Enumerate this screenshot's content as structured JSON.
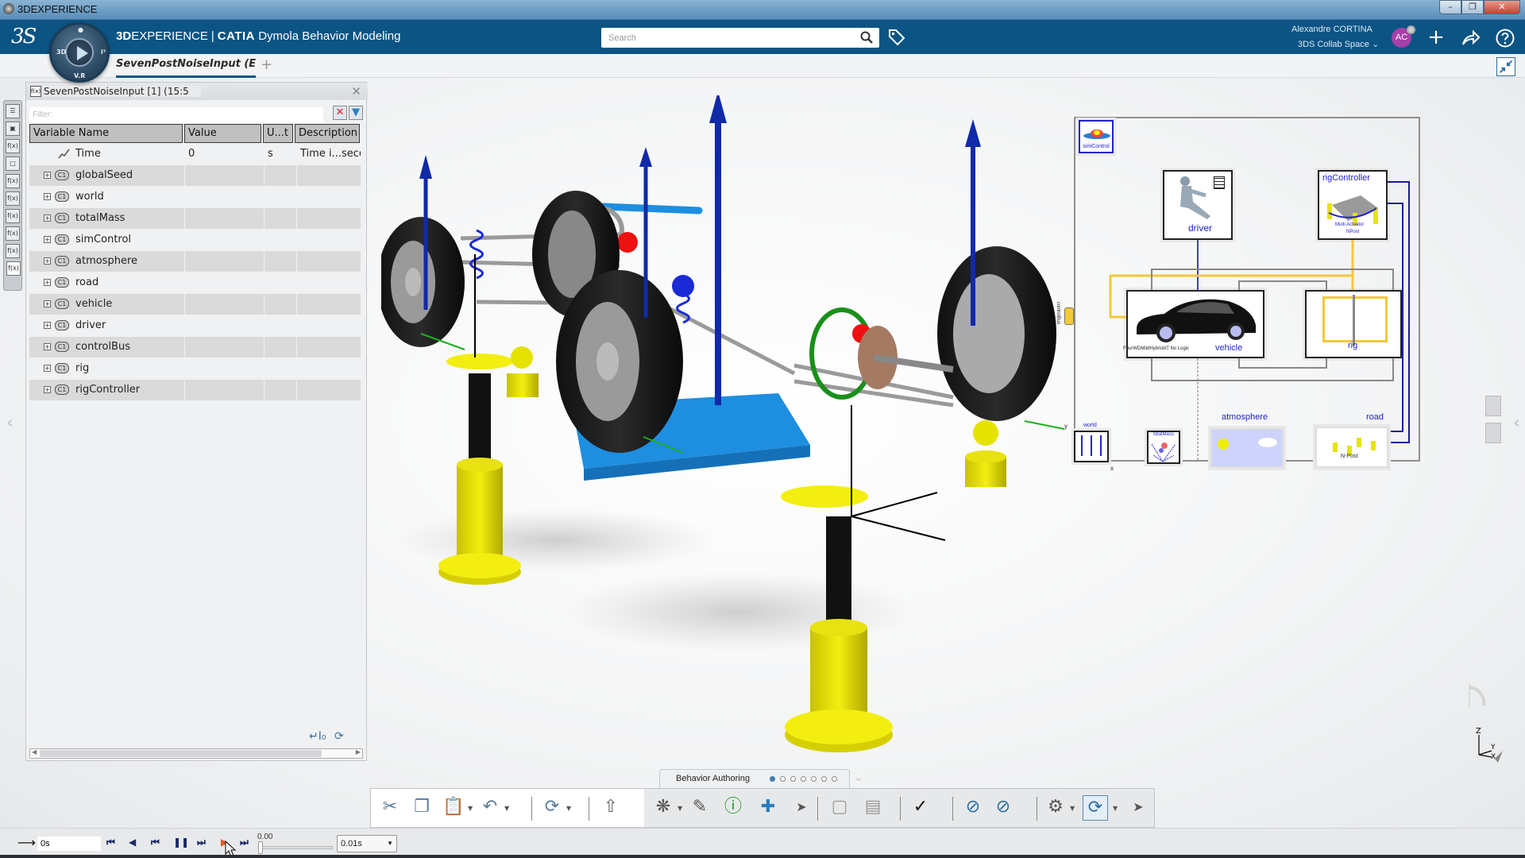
{
  "os_window": {
    "title": "3DEXPERIENCE",
    "buttons": [
      "minimize",
      "restore",
      "close"
    ]
  },
  "header": {
    "brand_3d": "3D",
    "brand_experience": "EXPERIENCE",
    "brand_separator": "|",
    "brand_catia": "CATIA",
    "app_name": "Dymola Behavior Modeling",
    "compass_labels": {
      "left": "3D",
      "bottom": "V.R",
      "right": "i³"
    },
    "search_placeholder": "Search",
    "user_name": "Alexandre CORTINA",
    "collab_space": "3DS Collab Space",
    "avatar_initials": "AC",
    "accent_color": "#0b5484",
    "avatar_color": "#a440a8"
  },
  "tabs": {
    "active_doc": "SevenPostNoiseInput (Encr",
    "add_label": "+"
  },
  "variable_browser": {
    "title": "SevenPostNoiseInput [1] (15:5",
    "filter_placeholder": "Filter:",
    "columns": [
      "Variable Name",
      "Value",
      "U...t",
      "Description"
    ],
    "rows": [
      {
        "name": "Time",
        "value": "0",
        "unit": "s",
        "description": "Time i...secor",
        "kind": "time"
      },
      {
        "name": "globalSeed",
        "value": "",
        "unit": "",
        "description": "",
        "kind": "class"
      },
      {
        "name": "world",
        "value": "",
        "unit": "",
        "description": "",
        "kind": "class"
      },
      {
        "name": "totalMass",
        "value": "",
        "unit": "",
        "description": "",
        "kind": "class"
      },
      {
        "name": "simControl",
        "value": "",
        "unit": "",
        "description": "",
        "kind": "class"
      },
      {
        "name": "atmosphere",
        "value": "",
        "unit": "",
        "description": "",
        "kind": "class"
      },
      {
        "name": "road",
        "value": "",
        "unit": "",
        "description": "",
        "kind": "class"
      },
      {
        "name": "vehicle",
        "value": "",
        "unit": "",
        "description": "",
        "kind": "class"
      },
      {
        "name": "driver",
        "value": "",
        "unit": "",
        "description": "",
        "kind": "class"
      },
      {
        "name": "controlBus",
        "value": "",
        "unit": "",
        "description": "",
        "kind": "class"
      },
      {
        "name": "rig",
        "value": "",
        "unit": "",
        "description": "",
        "kind": "class"
      },
      {
        "name": "rigController",
        "value": "",
        "unit": "",
        "description": "",
        "kind": "class"
      }
    ],
    "class_badge": "C1"
  },
  "diagram": {
    "blocks": {
      "simControl": "simControl",
      "driver": "driver",
      "rigController": "rigController",
      "rigController_sub": "Multi Actuator",
      "rigController_sub2": "NPost",
      "vehicle": "vehicle",
      "vehicle_sub": "FourWDMildHybridAT No Logic",
      "rig": "rig",
      "world": "world",
      "totalMass": "totalMass",
      "atmosphere": "atmosphere",
      "road": "road",
      "road_sub": "N-Post",
      "controlBus": "controlBus",
      "axis_x": "x",
      "axis_y": "y"
    }
  },
  "scene": {
    "axis_labels": {
      "z": "Z",
      "y": "Y",
      "x": "X"
    }
  },
  "behavior_bar": {
    "label": "Behavior Authoring",
    "page_count": 7,
    "active_page": 1
  },
  "action_bar": {
    "tools": [
      "cut",
      "copy",
      "paste",
      "undo",
      "refresh",
      "export",
      "new-behavior",
      "edit-behavior",
      "info",
      "add-connector",
      "next",
      "block",
      "split-block",
      "check",
      "disconnect-physical",
      "disconnect-logical",
      "settings",
      "simulate",
      "more"
    ]
  },
  "player": {
    "time_value": "0s",
    "slider_value": "0.00",
    "slider_fraction": 0.0,
    "step_value": "0.01s"
  }
}
